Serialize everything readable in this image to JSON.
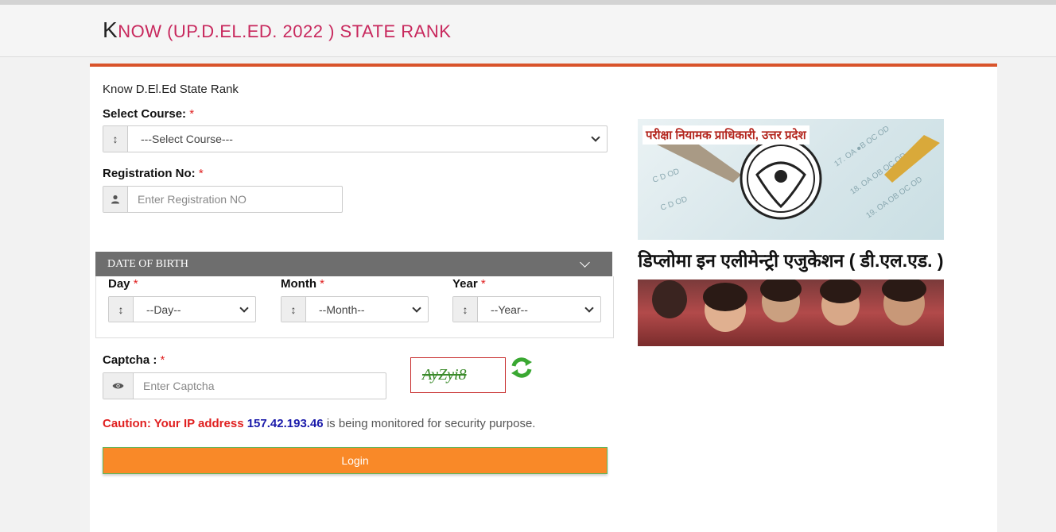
{
  "header": {
    "title_initial": "K",
    "title_rest": "NOW (UP.D.EL.ED. 2022 ) STATE RANK"
  },
  "form": {
    "intro": "Know D.El.Ed State Rank",
    "required_mark": "*",
    "course": {
      "label": "Select Course:",
      "value": "---Select Course---"
    },
    "registration": {
      "label": "Registration No:",
      "placeholder": "Enter Registration NO"
    },
    "dob": {
      "section_title": "DATE OF BIRTH",
      "day_label": "Day",
      "day_value": "--Day--",
      "month_label": "Month",
      "month_value": "--Month--",
      "year_label": "Year",
      "year_value": "--Year--"
    },
    "captcha": {
      "label": "Captcha :",
      "placeholder": "Enter Captcha",
      "image_text": "AyZyi8"
    },
    "caution": {
      "prefix": "Caution: Your IP address",
      "ip": "157.42.193.46",
      "suffix": "is being monitored for security purpose."
    },
    "login_label": "Login"
  },
  "banner": {
    "top_text": "परीक्षा नियामक प्राधिकारी, उत्तर प्रदेश",
    "main_text": "डिप्लोमा इन एलीमेन्ट्री एजुकेशन ( डी.एल.एड. )"
  },
  "colors": {
    "title": "#c8285d",
    "accent_bar": "#d9542b",
    "login_button": "#f98928",
    "caution_red": "#e02020",
    "ip_blue": "#1a1aaa"
  }
}
